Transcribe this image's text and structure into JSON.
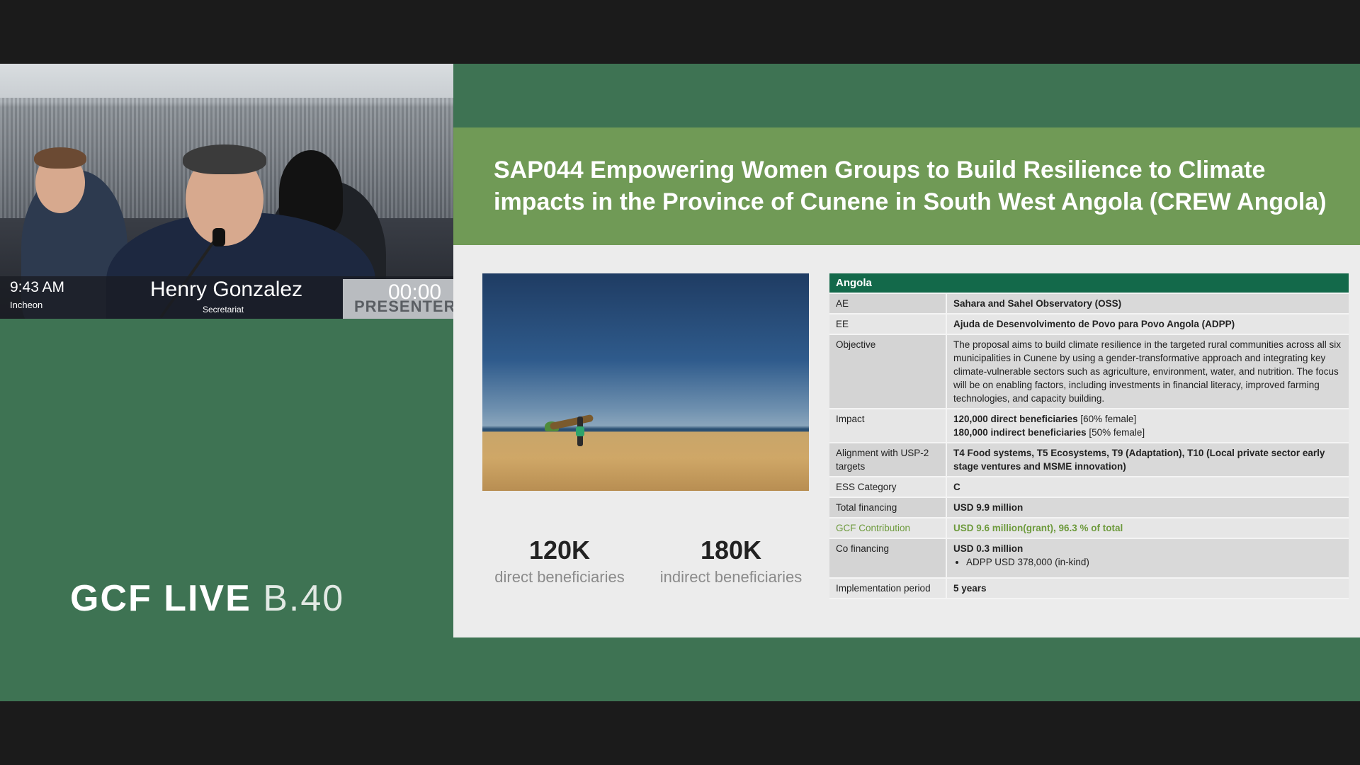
{
  "video": {
    "time": "9:43 AM",
    "location": "Incheon",
    "speaker_name": "Henry Gonzalez",
    "speaker_role": "Secretariat",
    "presenter_label": "PRESENTER",
    "timer": "00:00"
  },
  "brand": {
    "name": "GCF LIVE",
    "session": "B.40"
  },
  "slide": {
    "title": "SAP044 Empowering Women Groups to Build Resilience to Climate impacts in the Province of Cunene in South West Angola (CREW Angola)",
    "stats": [
      {
        "value": "120K",
        "label": "direct beneficiaries"
      },
      {
        "value": "180K",
        "label": "indirect beneficiaries"
      }
    ],
    "table": {
      "header": "Angola",
      "rows": [
        {
          "key": "AE",
          "value": "Sahara and Sahel Observatory (OSS)"
        },
        {
          "key": "EE",
          "value": "Ajuda de Desenvolvimento de Povo para Povo Angola (ADPP)"
        },
        {
          "key": "Objective",
          "value": "The proposal aims to build climate resilience in the targeted rural communities across all six municipalities in Cunene by using a gender-transformative approach and  integrating key climate-vulnerable sectors such as agriculture, environment, water, and nutrition. The focus will be on enabling factors, including investments in financial literacy, improved farming technologies, and capacity building."
        },
        {
          "key": "Impact",
          "value_line1_bold": "120,000 direct beneficiaries",
          "value_line1_rest": " [60% female]",
          "value_line2_bold": "180,000 indirect beneficiaries",
          "value_line2_rest": " [50% female]"
        },
        {
          "key": "Alignment with USP-2 targets",
          "value": "T4 Food systems, T5 Ecosystems, T9 (Adaptation), T10 (Local private sector early stage ventures and MSME innovation)"
        },
        {
          "key": "ESS Category",
          "value": "C"
        },
        {
          "key": "Total financing",
          "value": "USD 9.9 million"
        },
        {
          "key": "GCF Contribution",
          "value": "USD 9.6 million(grant), 96.3 % of total"
        },
        {
          "key": "Co financing",
          "value": "USD 0.3 million",
          "bullet": "ADPP USD 378,000 (in-kind)"
        },
        {
          "key": "Implementation period",
          "value": "5 years"
        }
      ]
    }
  },
  "colors": {
    "stage_green": "#3e7353",
    "header_green": "#709a56",
    "table_header": "#13694a",
    "gcf_contribution": "#6d9a3c"
  }
}
